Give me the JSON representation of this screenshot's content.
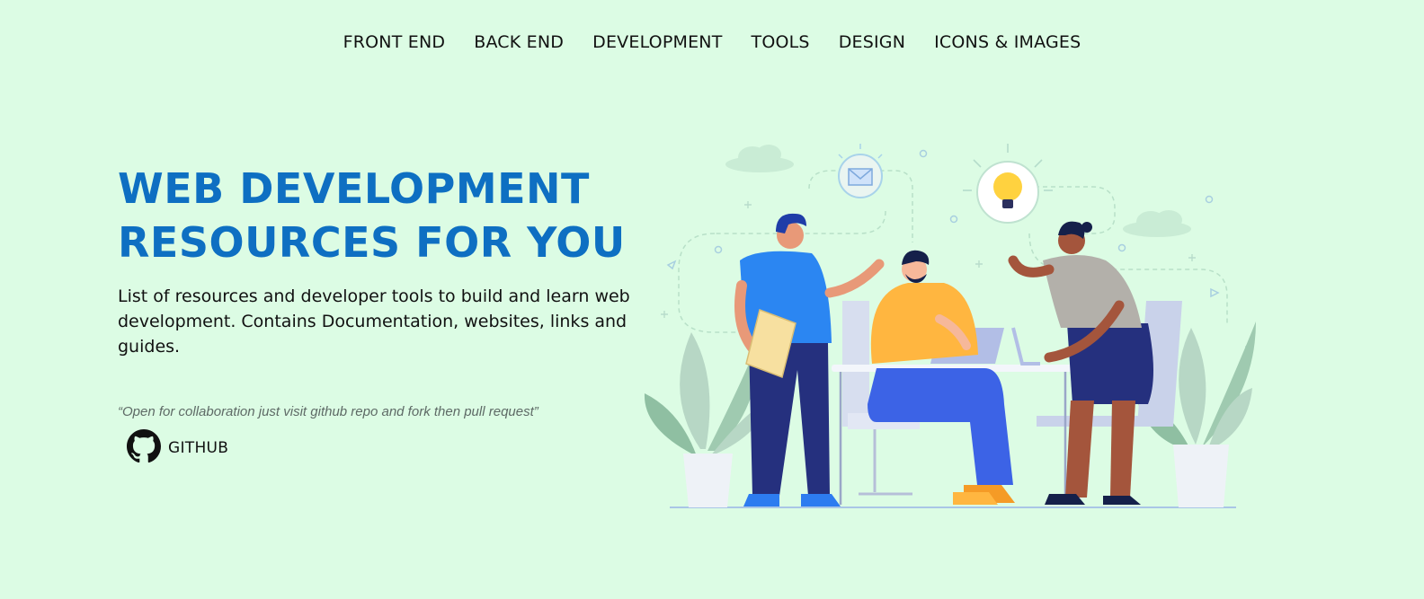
{
  "nav": {
    "items": [
      {
        "label": "FRONT END"
      },
      {
        "label": "BACK END"
      },
      {
        "label": "DEVELOPMENT"
      },
      {
        "label": "TOOLS"
      },
      {
        "label": "DESIGN"
      },
      {
        "label": "ICONS & IMAGES"
      }
    ]
  },
  "hero": {
    "title_line1": "WEB DEVELOPMENT",
    "title_line2": "RESOURCES FOR YOU",
    "description": "List of resources and developer tools to build and learn web development. Contains Documentation, websites, links and guides.",
    "quote": "“Open for collaboration just visit github repo and fork then pull request”",
    "github_label": "GITHUB",
    "github_icon": "github-icon"
  },
  "illustration": {
    "subject": "team-collaboration-illustration"
  },
  "colors": {
    "background": "#dcfce4",
    "title": "#0e6fc2",
    "text": "#111111",
    "quote": "#5e6a66"
  }
}
